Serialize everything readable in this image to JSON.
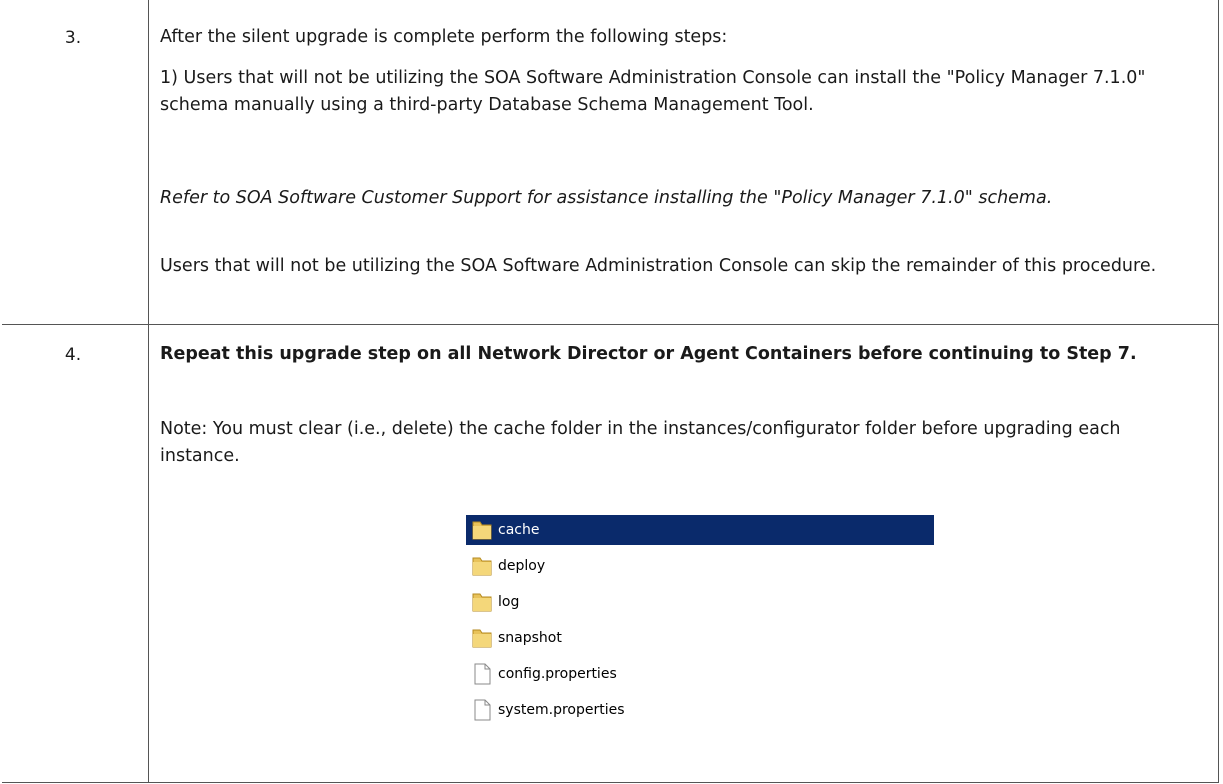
{
  "steps": [
    {
      "number": "3.",
      "paragraphs": [
        "After the silent upgrade is complete perform the following steps:",
        "1) Users that will not be utilizing the SOA Software Administration Console can install the \"Policy Manager 7.1.0\" schema manually using a third-party Database Schema Management Tool.",
        "Refer to SOA Software Customer Support for assistance installing the \"Policy Manager 7.1.0\" schema.",
        "Users that will not be utilizing the SOA Software Administration Console can skip the remainder of this procedure."
      ]
    },
    {
      "number": "4.",
      "heading": "Repeat this upgrade step on all Network Director or Agent Containers before continuing to Step 7.",
      "note": "Note: You must clear (i.e., delete) the cache folder in the instances/configurator folder before upgrading each instance."
    }
  ],
  "file_listing": {
    "items": [
      {
        "name": "cache",
        "type": "folder",
        "selected": true
      },
      {
        "name": "deploy",
        "type": "folder",
        "selected": false
      },
      {
        "name": "log",
        "type": "folder",
        "selected": false
      },
      {
        "name": "snapshot",
        "type": "folder",
        "selected": false
      },
      {
        "name": "config.properties",
        "type": "file",
        "selected": false
      },
      {
        "name": "system.properties",
        "type": "file",
        "selected": false
      }
    ],
    "selection_color": "#0a2a6b",
    "folder_icon": "folder-icon",
    "file_icon": "file-icon"
  }
}
